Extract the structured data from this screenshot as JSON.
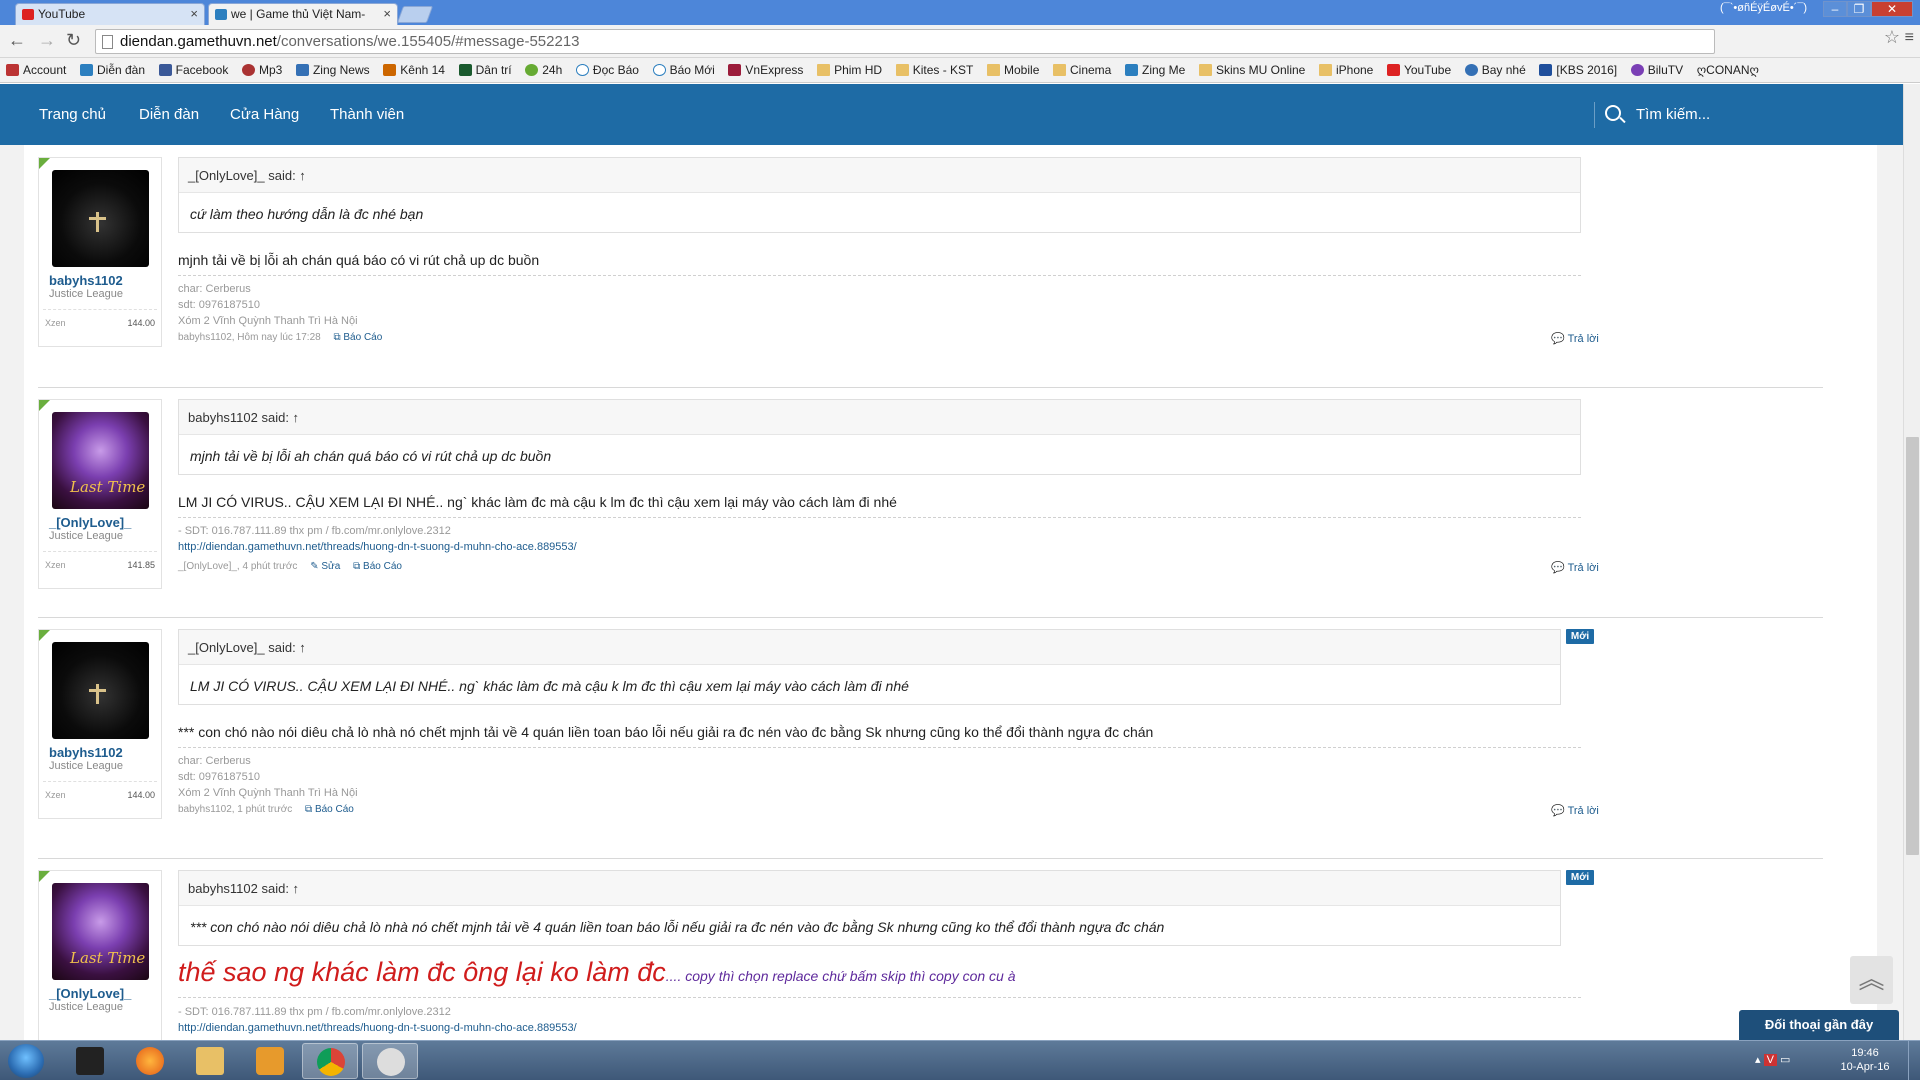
{
  "browser": {
    "tabs": [
      {
        "title": "YouTube",
        "active": false
      },
      {
        "title": "we | Game thủ Việt Nam-",
        "active": true
      }
    ],
    "profile_name": "(¯`•øñÉÿÉøvÉ•´¯)",
    "url_domain": "diendan.gamethuvn.net",
    "url_path": "/conversations/we.155405/#message-552213",
    "bookmarks": [
      "Account",
      "Diễn đàn",
      "Facebook",
      "Mp3",
      "Zing News",
      "Kênh 14",
      "Dân trí",
      "24h",
      "Đọc Báo",
      "Báo Mới",
      "VnExpress",
      "Phim HD",
      "Kites - KST",
      "Mobile",
      "Cinema",
      "Zing Me",
      "Skins MU Online",
      "iPhone",
      "YouTube",
      "Bay nhé",
      "[KBS 2016]",
      "BiluTV",
      "ღCONANღ"
    ]
  },
  "site": {
    "nav": [
      "Trang chủ",
      "Diễn đàn",
      "Cửa Hàng",
      "Thành viên"
    ],
    "search_label": "Tìm kiếm..."
  },
  "posts": [
    {
      "user": {
        "name": "babyhs1102",
        "title": "Justice League",
        "stat_label": "Xzen",
        "stat_value": "144.00"
      },
      "quote_author": "_[OnlyLove]_ said: ↑",
      "quote_text": "cứ làm theo hướng dẫn là đc nhé bạn",
      "message": "mjnh tải về bị lỗi ah chán quá báo có vi rút chả up dc buồn",
      "signature": [
        "char: Cerberus",
        "sdt: 0976187510",
        "Xóm 2 Vĩnh Quỳnh Thanh Trì Hà Nội"
      ],
      "meta": "babyhs1102, Hôm nay lúc 17:28",
      "actions": [
        "Báo Cáo"
      ],
      "reply": "Trả lời",
      "badge": ""
    },
    {
      "user": {
        "name": "_[OnlyLove]_",
        "title": "Justice League",
        "stat_label": "Xzen",
        "stat_value": "141.85"
      },
      "quote_author": "babyhs1102 said: ↑",
      "quote_text": "mjnh tải về bị lỗi ah chán quá báo có vi rút chả up dc buồn",
      "message": "LM JI CÓ VIRUS.. CẬU XEM LẠI ĐI NHÉ.. ng` khác làm đc mà cậu k lm đc thì cậu xem lại máy vào cách làm đi nhé",
      "signature": [
        "- SDT: 016.787.111.89 thx pm / fb.com/mr.onlylove.2312",
        "http://diendan.gamethuvn.net/threads/huong-dn-t-suong-d-muhn-cho-ace.889553/"
      ],
      "meta": "_[OnlyLove]_, 4 phút trước",
      "actions": [
        "Sửa",
        "Báo Cáo"
      ],
      "reply": "Trả lời",
      "badge": ""
    },
    {
      "user": {
        "name": "babyhs1102",
        "title": "Justice League",
        "stat_label": "Xzen",
        "stat_value": "144.00"
      },
      "quote_author": "_[OnlyLove]_ said: ↑",
      "quote_text": "LM JI CÓ VIRUS.. CẬU XEM LẠI ĐI NHÉ.. ng` khác làm đc mà cậu k lm đc thì cậu xem lại máy vào cách làm đi nhé",
      "message": "*** con chó nào nói diêu chả lò nhà nó chết mjnh tải về 4 quán liền toan báo lỗi nếu giải ra đc nén vào đc bằng Sk nhưng cũng ko thể đổi thành ngựa đc chán",
      "signature": [
        "char: Cerberus",
        "sdt: 0976187510",
        "Xóm 2 Vĩnh Quỳnh Thanh Trì Hà Nội"
      ],
      "meta": "babyhs1102, 1 phút trước",
      "actions": [
        "Báo Cáo"
      ],
      "reply": "Trả lời",
      "badge": "Mới"
    },
    {
      "user": {
        "name": "_[OnlyLove]_",
        "title": "Justice League",
        "stat_label": "",
        "stat_value": ""
      },
      "quote_author": "babyhs1102 said: ↑",
      "quote_text": "*** con chó nào nói diêu chả lò nhà nó chết mjnh tải về 4 quán liền toan báo lỗi nếu giải ra đc nén vào đc bằng Sk nhưng cũng ko thể đổi thành ngựa đc chán",
      "message_big": "thế sao ng khác làm đc ông lại ko làm đc",
      "message_small": ".... copy thì chọn replace chứ bấm skip thì copy con cu à",
      "signature": [
        "- SDT: 016.787.111.89 thx pm / fb.com/mr.onlylove.2312",
        "http://diendan.gamethuvn.net/threads/huong-dn-t-suong-d-muhn-cho-ace.889553/"
      ],
      "badge": "Mới"
    }
  ],
  "widgets": {
    "recent_conversations": "Đối thoại gần đây",
    "back_to_top_icon": "chevron-double-up-icon"
  },
  "taskbar": {
    "time": "19:46",
    "date": "10-Apr-16"
  },
  "colors": {
    "site_nav": "#1e6ba5",
    "username": "#1e5c8e",
    "big_red": "#d01c1c",
    "purple_text": "#5f2a9c"
  }
}
